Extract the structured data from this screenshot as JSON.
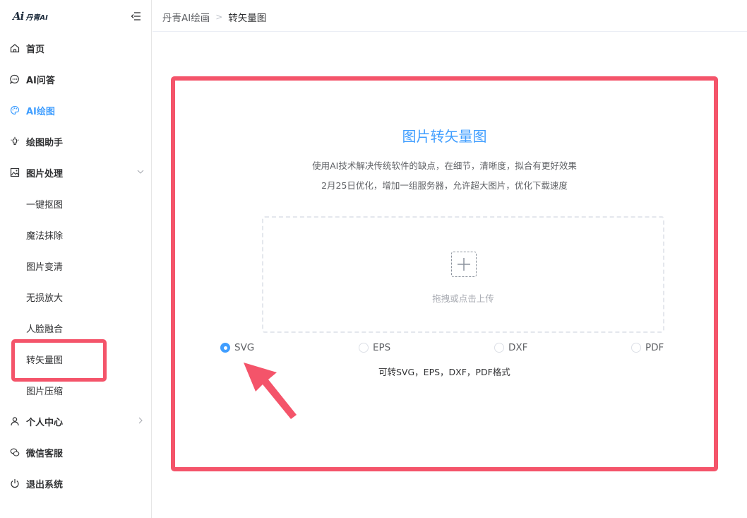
{
  "app": {
    "logo_mark": "Ai",
    "logo_text": "丹青AI"
  },
  "sidebar": {
    "items": [
      {
        "label": "首页",
        "icon": "home-icon"
      },
      {
        "label": "AI问答",
        "icon": "chat-icon"
      },
      {
        "label": "AI绘图",
        "icon": "palette-icon",
        "active": true
      },
      {
        "label": "绘图助手",
        "icon": "lightbulb-icon"
      },
      {
        "label": "图片处理",
        "icon": "image-icon",
        "expanded": true
      }
    ],
    "sub_items": [
      {
        "label": "一键抠图"
      },
      {
        "label": "魔法抹除"
      },
      {
        "label": "图片变清"
      },
      {
        "label": "无损放大"
      },
      {
        "label": "人脸融合"
      },
      {
        "label": "转矢量图",
        "active": true
      },
      {
        "label": "图片压缩"
      }
    ],
    "bottom_items": [
      {
        "label": "个人中心",
        "icon": "user-icon"
      },
      {
        "label": "微信客服",
        "icon": "wechat-icon"
      },
      {
        "label": "退出系统",
        "icon": "power-icon"
      }
    ]
  },
  "header": {
    "breadcrumb": [
      "丹青AI绘画",
      "转矢量图"
    ],
    "separator": ">"
  },
  "main": {
    "title": "图片转矢量图",
    "desc1": "使用AI技术解决传统软件的缺点，在细节，清晰度，拟合有更好效果",
    "desc2": "2月25日优化，增加一组服务器，允许超大图片，优化下载速度",
    "upload_text": "拖拽或点击上传",
    "formats": [
      {
        "label": "SVG",
        "checked": true
      },
      {
        "label": "EPS",
        "checked": false
      },
      {
        "label": "DXF",
        "checked": false
      },
      {
        "label": "PDF",
        "checked": false
      }
    ],
    "formats_note": "可转SVG，EPS，DXF，PDF格式"
  },
  "colors": {
    "accent": "#409eff",
    "highlight": "#f4546a"
  }
}
